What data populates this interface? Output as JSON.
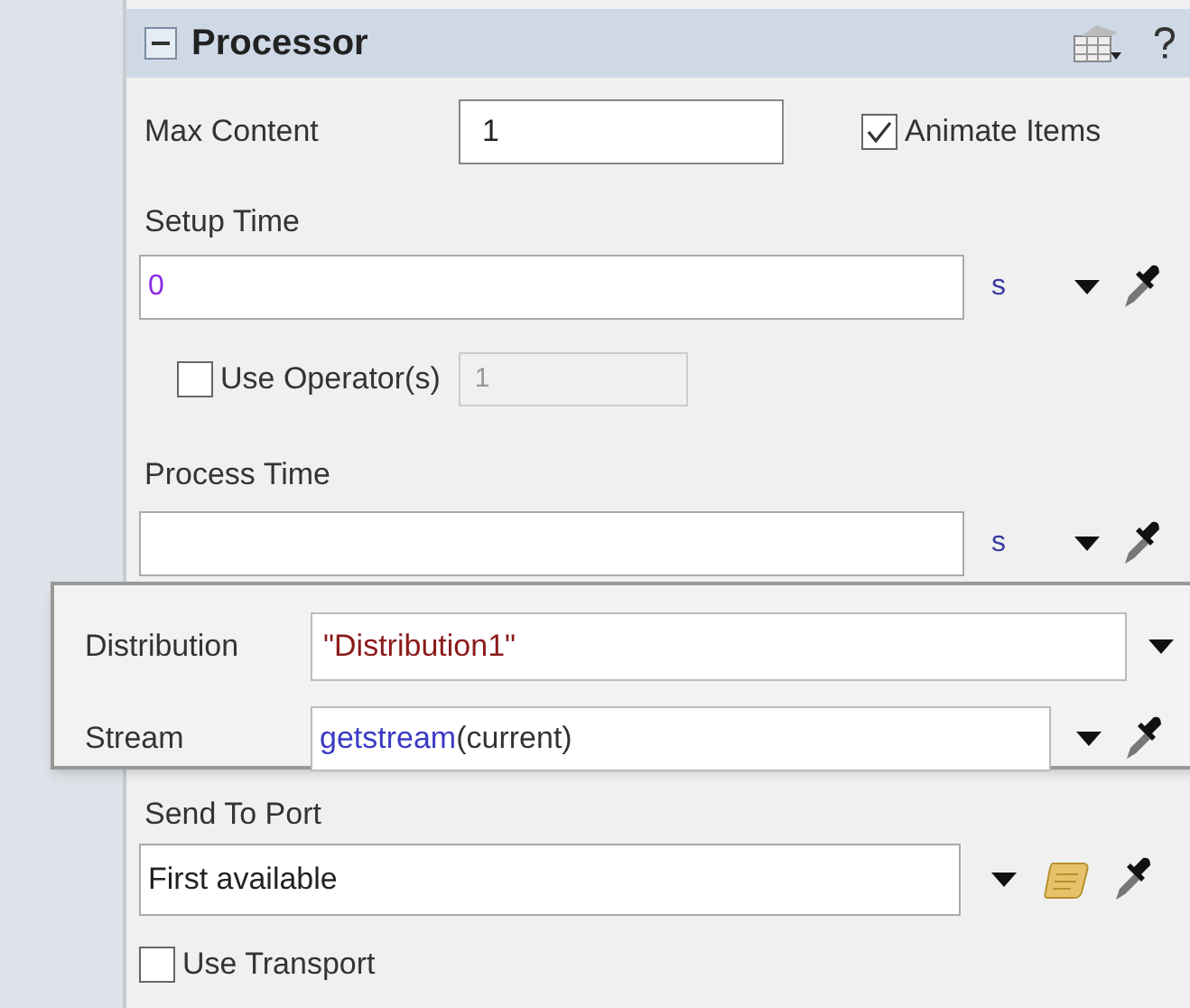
{
  "panel": {
    "title": "Processor",
    "expanded": true
  },
  "max_content": {
    "label": "Max Content",
    "value": "1"
  },
  "animate_items": {
    "label": "Animate Items",
    "checked": true
  },
  "setup_time": {
    "label": "Setup Time",
    "value": "0",
    "unit": "s"
  },
  "use_operators": {
    "label": "Use Operator(s)",
    "checked": false,
    "count": "1"
  },
  "process_time": {
    "label": "Process Time",
    "unit": "s"
  },
  "popup": {
    "distribution": {
      "label": "Distribution",
      "value": "\"Distribution1\""
    },
    "stream": {
      "label": "Stream",
      "function": "getstream",
      "args": "(current)"
    }
  },
  "send_to_port": {
    "label": "Send To Port",
    "value": "First available"
  },
  "use_transport": {
    "label": "Use Transport",
    "checked": false
  }
}
